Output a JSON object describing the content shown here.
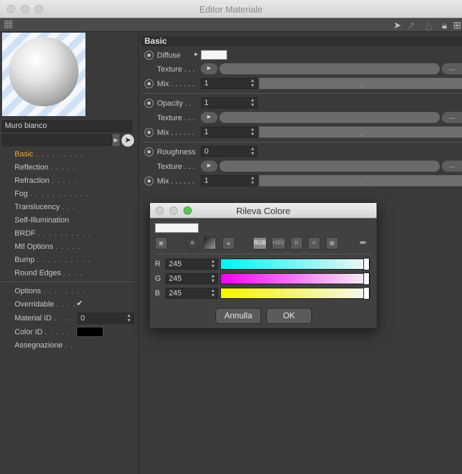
{
  "window": {
    "title": "Editor Materiale"
  },
  "material": {
    "name": "Muro bianco"
  },
  "channels": [
    {
      "label": "Basic",
      "dots": ". . . . . . . . ."
    },
    {
      "label": "Reflection",
      "dots": ". . . . ."
    },
    {
      "label": "Refraction",
      "dots": ". . . . ."
    },
    {
      "label": "Fog",
      "dots": ". . . . . . . . . . ."
    },
    {
      "label": "Translucency",
      "dots": ". . ."
    },
    {
      "label": "Self-Illumination",
      "dots": ""
    },
    {
      "label": "BRDF",
      "dots": ". . . . . . . . . ."
    },
    {
      "label": "Mtl Options",
      "dots": ". . . . ."
    },
    {
      "label": "Bump",
      "dots": ". . . . . . . . . ."
    },
    {
      "label": "Round Edges",
      "dots": ". . . ."
    }
  ],
  "options": [
    {
      "label": "Options",
      "dots": ". . . . . . . ."
    },
    {
      "label": "Overridable",
      "dots": ". . . ."
    },
    {
      "label": "Material ID",
      "dots": ". . . . ."
    },
    {
      "label": "Color ID",
      "dots": ". . . . . . ."
    },
    {
      "label": "Assegnazione",
      "dots": ". ."
    }
  ],
  "material_id_value": "0",
  "overridable_checked": "✔",
  "basic": {
    "header": "Basic",
    "diffuse_label": "Diffuse",
    "texture_label": "Texture . . .",
    "mix_label": "Mix . . . . . .",
    "mix1_value": "1",
    "opacity_label": "Opacity . .",
    "opacity_value": "1",
    "mix2_value": "1",
    "roughness_label": "Roughness",
    "roughness_value": "0",
    "mix3_value": "1",
    "more_label": "..."
  },
  "color_dialog": {
    "title": "Rileva Colore",
    "modes": [
      "RGB",
      "HSV",
      "K"
    ],
    "r_label": "R",
    "r_value": "245",
    "g_label": "G",
    "g_value": "245",
    "b_label": "B",
    "b_value": "245",
    "cancel_label": "Annulla",
    "ok_label": "OK"
  },
  "colors": {
    "accent": "#f0a830",
    "dialog_green": "#5fc453"
  }
}
